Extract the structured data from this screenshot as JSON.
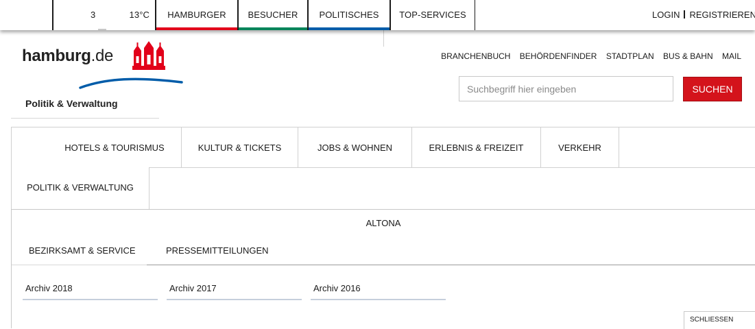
{
  "topbar": {
    "count": "3",
    "temperature": "13°C",
    "items": [
      {
        "label": "HAMBURGER",
        "color": "#e2001a"
      },
      {
        "label": "BESUCHER",
        "color": "#00845a"
      },
      {
        "label": "POLITISCHES",
        "color": "#005ca9"
      },
      {
        "label": "TOP-SERVICES",
        "color": ""
      }
    ],
    "login": "LOGIN",
    "register": "REGISTRIEREN"
  },
  "header": {
    "logo_main": "hamburg",
    "logo_suffix": ".de",
    "subtitle": "Politik & Verwaltung",
    "crest_color": "#e2001a",
    "wave_color": "#005ca9",
    "quicklinks": [
      "BRANCHENBUCH",
      "BEHÖRDENFINDER",
      "STADTPLAN",
      "BUS & BAHN",
      "MAIL"
    ],
    "search_placeholder": "Suchbegriff hier eingeben",
    "search_button": "SUCHEN"
  },
  "mainnav": {
    "tabs": [
      "HOTELS & TOURISMUS",
      "KULTUR & TICKETS",
      "JOBS & WOHNEN",
      "ERLEBNIS & FREIZEIT",
      "VERKEHR"
    ],
    "active": "POLITIK & VERWALTUNG"
  },
  "subpanel": {
    "title": "ALTONA",
    "tabs": [
      "BEZIRKSAMT & SERVICE",
      "PRESSEMITTEILUNGEN"
    ],
    "archives": [
      "Archiv 2018",
      "Archiv 2017",
      "Archiv 2016"
    ],
    "close": "SCHLIESSEN"
  }
}
